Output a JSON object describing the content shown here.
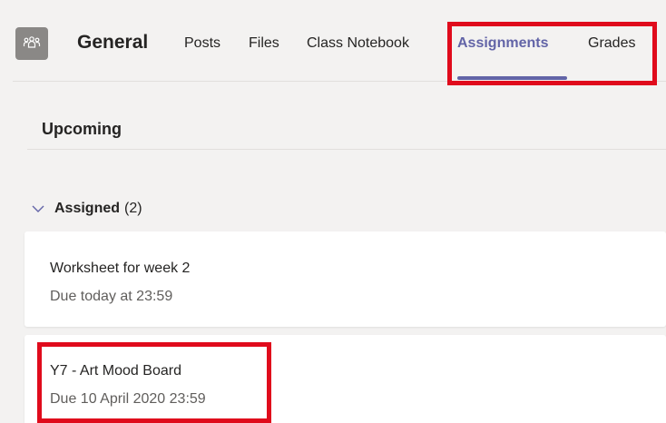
{
  "header": {
    "channel_title": "General",
    "team_icon": "team-people-icon",
    "tabs": [
      {
        "label": "Posts",
        "active": false
      },
      {
        "label": "Files",
        "active": false
      },
      {
        "label": "Class Notebook",
        "active": false
      },
      {
        "label": "Assignments",
        "active": true
      },
      {
        "label": "Grades",
        "active": false
      }
    ]
  },
  "main": {
    "section_title": "Upcoming",
    "group": {
      "label": "Assigned",
      "count": "(2)",
      "icon": "chevron-down-icon"
    },
    "assignments": [
      {
        "title": "Worksheet for week 2",
        "due": "Due today at 23:59"
      },
      {
        "title": "Y7 - Art Mood Board",
        "due": "Due 10 April 2020 23:59"
      }
    ]
  },
  "colors": {
    "accent": "#6264a7",
    "highlight": "#e00b1c",
    "background": "#f3f2f1",
    "card": "#ffffff",
    "secondary_text": "#605e5c"
  }
}
